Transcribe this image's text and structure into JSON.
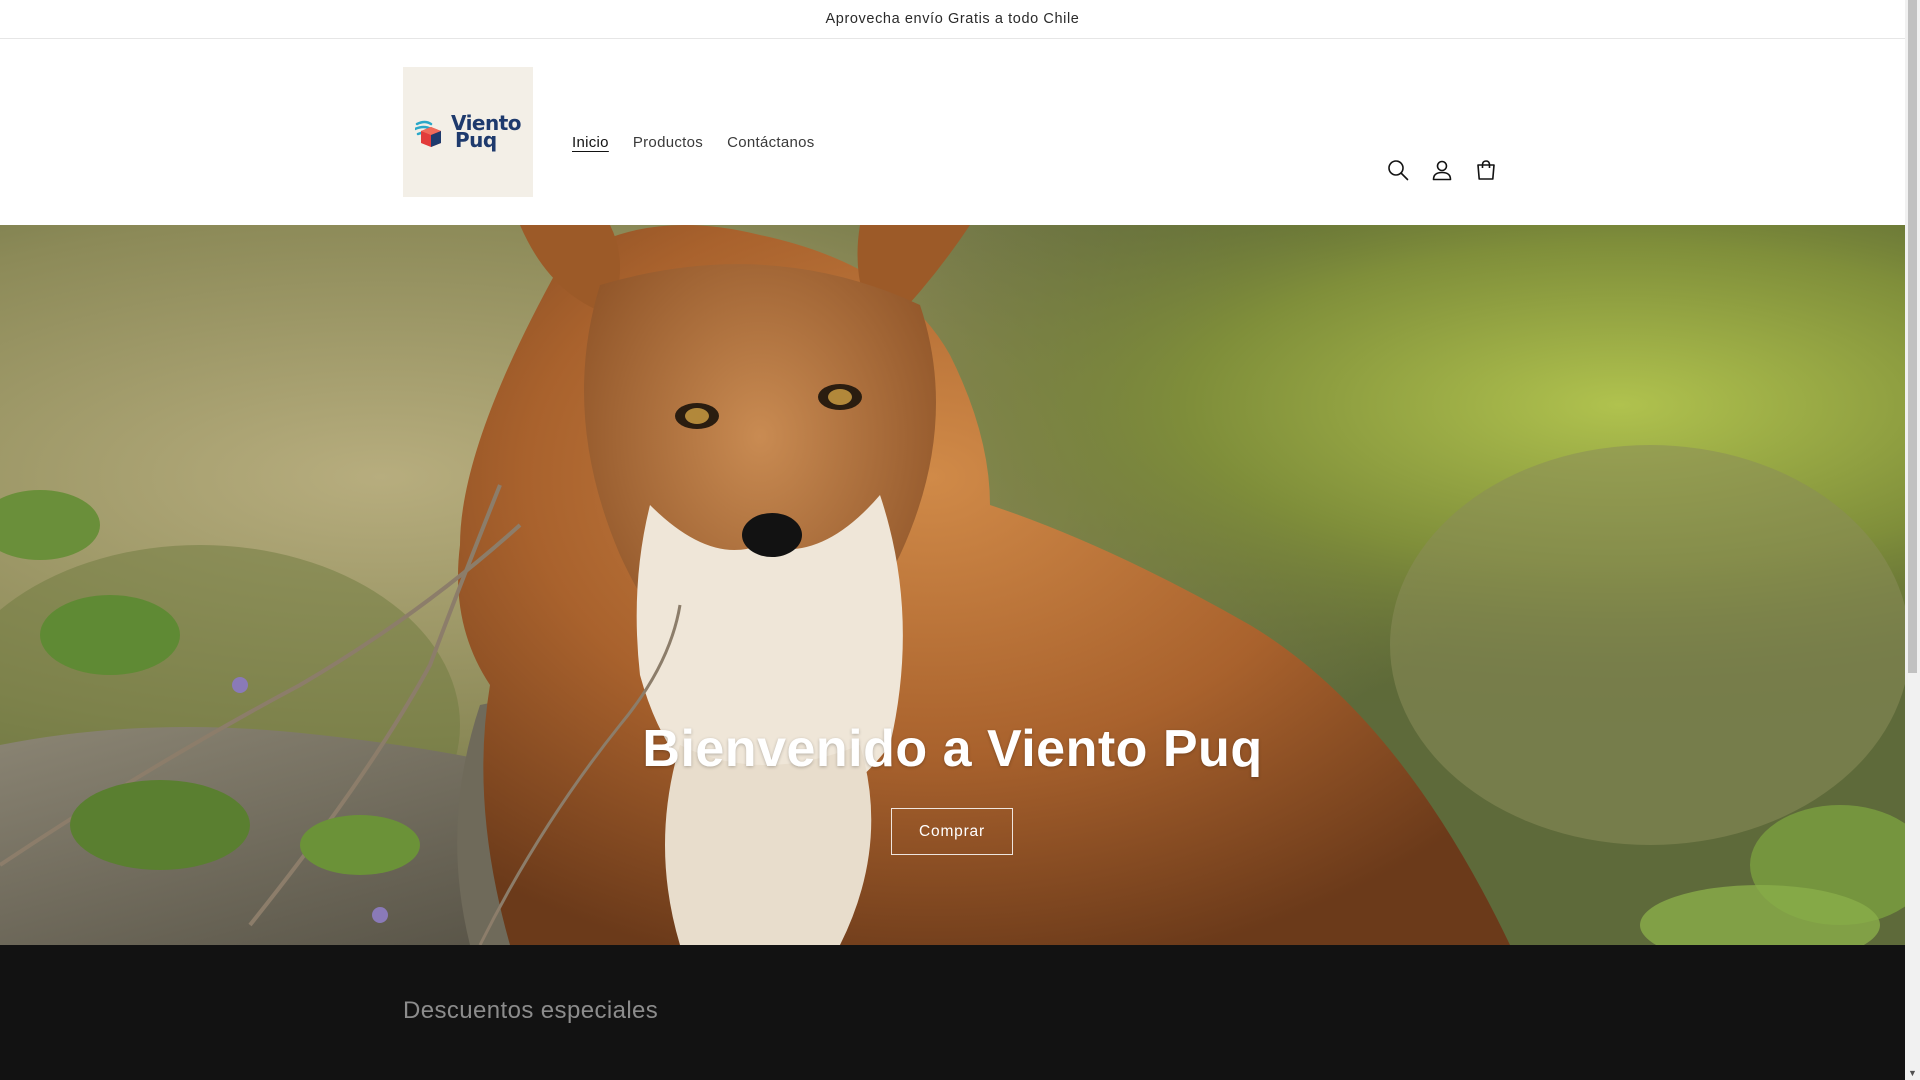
{
  "announcement": {
    "text": "Aprovecha envío Gratis a todo Chile"
  },
  "header": {
    "logo": {
      "line1": "Viento",
      "line2": "Puq"
    },
    "nav": [
      {
        "label": "Inicio",
        "active": true
      },
      {
        "label": "Productos",
        "active": false
      },
      {
        "label": "Contáctanos",
        "active": false
      }
    ],
    "icons": [
      "search-icon",
      "account-icon",
      "cart-icon"
    ]
  },
  "hero": {
    "title": "Bienvenido a Viento Puq",
    "button_label": "Comprar"
  },
  "featured": {
    "heading": "Descuentos especiales"
  },
  "colors": {
    "dark_section": "#121212",
    "logo_bg": "#f3efe7",
    "logo_text": "#1e3a6d",
    "logo_accent": "#e23b3b"
  }
}
